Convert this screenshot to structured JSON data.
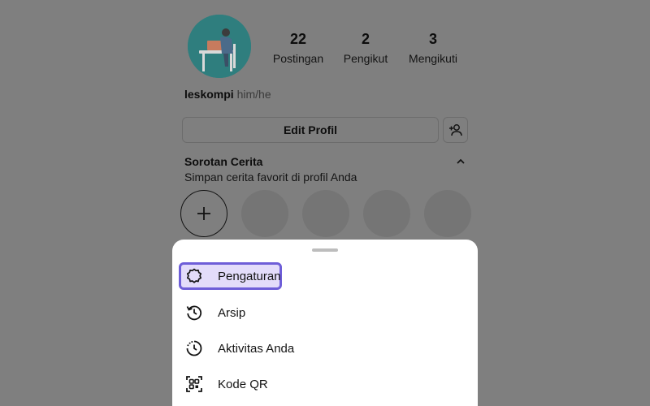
{
  "profile": {
    "username": "leskompi",
    "pronouns": "him/he",
    "stats": [
      {
        "count": "22",
        "label": "Postingan"
      },
      {
        "count": "2",
        "label": "Pengikut"
      },
      {
        "count": "3",
        "label": "Mengikuti"
      }
    ],
    "edit_button": "Edit Profil",
    "add_user_icon": "person-add-icon"
  },
  "highlights": {
    "title": "Sorotan Cerita",
    "subtitle": "Simpan cerita favorit di profil Anda",
    "toggle_icon": "chevron-up-icon",
    "new_icon": "plus-icon"
  },
  "menu": {
    "items": [
      {
        "label": "Pengaturan",
        "icon": "settings-icon",
        "selected": true
      },
      {
        "label": "Arsip",
        "icon": "archive-history-icon"
      },
      {
        "label": "Aktivitas Anda",
        "icon": "activity-clock-icon"
      },
      {
        "label": "Kode QR",
        "icon": "qr-code-icon"
      }
    ]
  },
  "colors": {
    "overlay": "#7f7f7f",
    "sheet": "#ffffff",
    "selection_border": "#6e5ed8",
    "selection_fill": "#e3dcfa",
    "avatar_bg": "#2f7e7e"
  }
}
